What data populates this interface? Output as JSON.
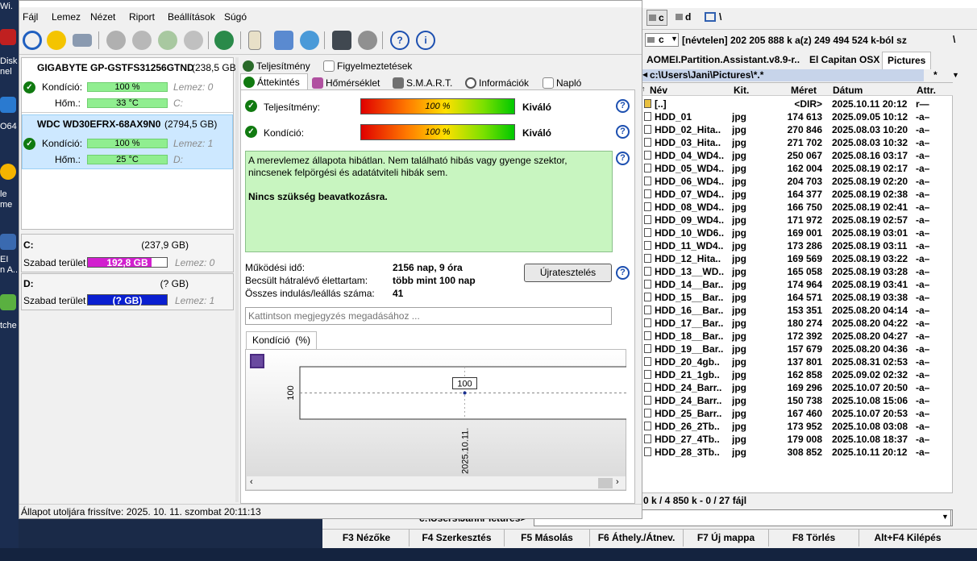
{
  "desktop": {
    "labels": [
      "Wi.",
      "Disk\nnel",
      "O64",
      "le\nme",
      "EI\nn A...",
      "tche"
    ]
  },
  "hds": {
    "menu": [
      "Fájl",
      "Lemez",
      "Nézet",
      "Riport",
      "Beállítások",
      "Súgó"
    ],
    "disks": [
      {
        "name": "GIGABYTE GP-GSTFS31256GTND",
        "size": "(238,5 GB)",
        "health_label": "Kondíció:",
        "health": "100 %",
        "temp_label": "Hőm.:",
        "temp": "33 °C",
        "disk_id": "Lemez: 0",
        "drive": "C:"
      },
      {
        "name": "WDC WD30EFRX-68AX9N0",
        "size": "(2794,5 GB)",
        "health_label": "Kondíció:",
        "health": "100 %",
        "temp_label": "Hőm.:",
        "temp": "25 °C",
        "disk_id": "Lemez: 1",
        "drive": "D:"
      }
    ],
    "volumes": [
      {
        "letter": "C:",
        "size": "(237,9 GB)",
        "free_label": "Szabad terület",
        "free": "192,8 GB",
        "disk_id": "Lemez: 0",
        "fill": 0.81
      },
      {
        "letter": "D:",
        "size": "(? GB)",
        "free_label": "Szabad terület",
        "free": "(? GB)",
        "disk_id": "Lemez: 1",
        "fill": 1.0
      }
    ],
    "tabs_top": [
      "Teljesítmény",
      "Figyelmeztetések"
    ],
    "tabs": [
      "Áttekintés",
      "Hőmérséklet",
      "S.M.A.R.T.",
      "Információk",
      "Napló"
    ],
    "performance_label": "Teljesítmény:",
    "performance": "100 %",
    "performance_rating": "Kiváló",
    "health_label": "Kondíció:",
    "health": "100 %",
    "health_rating": "Kiváló",
    "status_text": "A merevlemez állapota hibátlan. Nem található hibás vagy gyenge szektor, nincsenek felpörgési és adatátviteli hibák sem.",
    "status_action": "Nincs szükség beavatkozásra.",
    "stats": [
      {
        "label": "Működési idő:",
        "value": "2156 nap, 9 óra"
      },
      {
        "label": "Becsült hátralévő élettartam:",
        "value": "több mint 100 nap"
      },
      {
        "label": "Összes indulás/leállás száma:",
        "value": "41"
      }
    ],
    "retest": "Újratesztelés",
    "note_placeholder": "Kattintson megjegyzés megadásához ...",
    "chart_tab": "Kondíció  (%)",
    "status_bar": "Állapot utoljára frissítve: 2025. 10. 11. szombat 20:11:13"
  },
  "chart_data": {
    "type": "line",
    "x": [
      "2025.10.11."
    ],
    "values": [
      100
    ],
    "ylabel": "100",
    "data_label": "100",
    "grid": "horizontal dashed"
  },
  "tc": {
    "drives": [
      "c",
      "d",
      "\\"
    ],
    "drive_select": "c",
    "volume_info": "[névtelen]  202 205 888 k a(z) 249 494 524 k-ból sz",
    "tabs": [
      "AOMEI.Partition.Assistant.v8.9-r..",
      "El Capitan OSX",
      "Pictures"
    ],
    "path": "c:\\Users\\Jani\\Pictures\\*.*",
    "path_filter": "*",
    "cols": [
      "Név",
      "Kit.",
      "Méret",
      "Dátum",
      "Attr."
    ],
    "rows": [
      {
        "name": "[..]",
        "ext": "",
        "size": "<DIR>",
        "date": "2025.10.11 20:12",
        "attr": "r—"
      },
      {
        "name": "HDD_01",
        "ext": "jpg",
        "size": "174 613",
        "date": "2025.09.05 10:12",
        "attr": "-a–"
      },
      {
        "name": "HDD_02_Hita..",
        "ext": "jpg",
        "size": "270 846",
        "date": "2025.08.03 10:20",
        "attr": "-a–"
      },
      {
        "name": "HDD_03_Hita..",
        "ext": "jpg",
        "size": "271 702",
        "date": "2025.08.03 10:32",
        "attr": "-a–"
      },
      {
        "name": "HDD_04_WD4..",
        "ext": "jpg",
        "size": "250 067",
        "date": "2025.08.16 03:17",
        "attr": "-a–"
      },
      {
        "name": "HDD_05_WD4..",
        "ext": "jpg",
        "size": "162 004",
        "date": "2025.08.19 02:17",
        "attr": "-a–"
      },
      {
        "name": "HDD_06_WD4..",
        "ext": "jpg",
        "size": "204 703",
        "date": "2025.08.19 02:20",
        "attr": "-a–"
      },
      {
        "name": "HDD_07_WD4..",
        "ext": "jpg",
        "size": "164 377",
        "date": "2025.08.19 02:38",
        "attr": "-a–"
      },
      {
        "name": "HDD_08_WD4..",
        "ext": "jpg",
        "size": "166 750",
        "date": "2025.08.19 02:41",
        "attr": "-a–"
      },
      {
        "name": "HDD_09_WD4..",
        "ext": "jpg",
        "size": "171 972",
        "date": "2025.08.19 02:57",
        "attr": "-a–"
      },
      {
        "name": "HDD_10_WD6..",
        "ext": "jpg",
        "size": "169 001",
        "date": "2025.08.19 03:01",
        "attr": "-a–"
      },
      {
        "name": "HDD_11_WD4..",
        "ext": "jpg",
        "size": "173 286",
        "date": "2025.08.19 03:11",
        "attr": "-a–"
      },
      {
        "name": "HDD_12_Hita..",
        "ext": "jpg",
        "size": "169 569",
        "date": "2025.08.19 03:22",
        "attr": "-a–"
      },
      {
        "name": "HDD_13__WD..",
        "ext": "jpg",
        "size": "165 058",
        "date": "2025.08.19 03:28",
        "attr": "-a–"
      },
      {
        "name": "HDD_14__Bar..",
        "ext": "jpg",
        "size": "174 964",
        "date": "2025.08.19 03:41",
        "attr": "-a–"
      },
      {
        "name": "HDD_15__Bar..",
        "ext": "jpg",
        "size": "164 571",
        "date": "2025.08.19 03:38",
        "attr": "-a–"
      },
      {
        "name": "HDD_16__Bar..",
        "ext": "jpg",
        "size": "153 351",
        "date": "2025.08.20 04:14",
        "attr": "-a–"
      },
      {
        "name": "HDD_17__Bar..",
        "ext": "jpg",
        "size": "180 274",
        "date": "2025.08.20 04:22",
        "attr": "-a–"
      },
      {
        "name": "HDD_18__Bar..",
        "ext": "jpg",
        "size": "172 392",
        "date": "2025.08.20 04:27",
        "attr": "-a–"
      },
      {
        "name": "HDD_19__Bar..",
        "ext": "jpg",
        "size": "157 679",
        "date": "2025.08.20 04:36",
        "attr": "-a–"
      },
      {
        "name": "HDD_20_4gb..",
        "ext": "jpg",
        "size": "137 801",
        "date": "2025.08.31 02:53",
        "attr": "-a–"
      },
      {
        "name": "HDD_21_1gb..",
        "ext": "jpg",
        "size": "162 858",
        "date": "2025.09.02 02:32",
        "attr": "-a–"
      },
      {
        "name": "HDD_24_Barr..",
        "ext": "jpg",
        "size": "169 296",
        "date": "2025.10.07 20:50",
        "attr": "-a–"
      },
      {
        "name": "HDD_24_Barr..",
        "ext": "jpg",
        "size": "150 738",
        "date": "2025.10.08 15:06",
        "attr": "-a–"
      },
      {
        "name": "HDD_25_Barr..",
        "ext": "jpg",
        "size": "167 460",
        "date": "2025.10.07 20:53",
        "attr": "-a–"
      },
      {
        "name": "HDD_26_2Tb..",
        "ext": "jpg",
        "size": "173 952",
        "date": "2025.10.08 03:08",
        "attr": "-a–"
      },
      {
        "name": "HDD_27_4Tb..",
        "ext": "jpg",
        "size": "179 008",
        "date": "2025.10.08 18:37",
        "attr": "-a–"
      },
      {
        "name": "HDD_28_3Tb..",
        "ext": "jpg",
        "size": "308 852",
        "date": "2025.10.11 20:12",
        "attr": "-a–"
      }
    ],
    "footer": "0 k / 4 850 k - 0 / 27 fájl",
    "cmd_path": "c:\\Users\\Jani\\Pictures>",
    "fkeys": [
      "F3 Nézőke",
      "F4 Szerkesztés",
      "F5 Másolás",
      "F6 Áthely./Átnev.",
      "F7 Új mappa",
      "F8 Törlés",
      "Alt+F4 Kilépés"
    ]
  },
  "colors": {
    "ok": "#107a10",
    "health_bar": "#90ee90",
    "status_bg": "#c8f5c0",
    "free_c": "#d21fcf",
    "free_d": "#0a1fd0",
    "selected": "#cde8ff"
  }
}
